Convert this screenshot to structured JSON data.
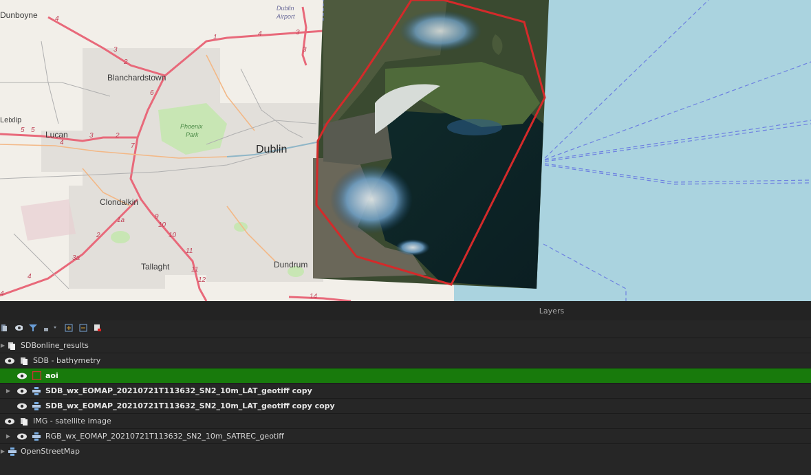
{
  "map": {
    "labels": {
      "dunboyne": "Dunboyne",
      "dublin_airport": "Dublin\nAirport",
      "blanchardstown": "Blanchardstown",
      "leixlip": "Leixlip",
      "lucan": "Lucan",
      "phoenix_park": "Phoenix\nPark",
      "dublin": "Dublin",
      "clondalkin": "Clondalkin",
      "tallaght": "Tallaght",
      "dundrum": "Dundrum"
    },
    "colors": {
      "aoi_outline": "#d42a2a",
      "sea": "#aad3df",
      "land": "#f2efe9",
      "road": "#e8697a"
    }
  },
  "panel": {
    "title": "Layers",
    "toolbar_icons": [
      "open-layer-styling-icon",
      "manage-visibility-icon",
      "filter-legend-icon",
      "filter-expression-icon",
      "expand-all-icon",
      "collapse-all-icon",
      "remove-layer-icon"
    ],
    "layers": [
      {
        "label": "SDBonline_results",
        "type": "group"
      },
      {
        "label": "SDB - bathymetry",
        "type": "group"
      },
      {
        "label": "aoi",
        "type": "vector"
      },
      {
        "label": "SDB_wx_EOMAP_20210721T113632_SN2_10m_LAT_geotiff copy",
        "type": "raster"
      },
      {
        "label": "SDB_wx_EOMAP_20210721T113632_SN2_10m_LAT_geotiff copy copy",
        "type": "raster"
      },
      {
        "label": "IMG - satellite image",
        "type": "group"
      },
      {
        "label": "RGB_wx_EOMAP_20210721T113632_SN2_10m_SATREC_geotiff",
        "type": "raster"
      },
      {
        "label": "OpenStreetMap",
        "type": "tile"
      }
    ],
    "selection_color": "#187a0c"
  }
}
